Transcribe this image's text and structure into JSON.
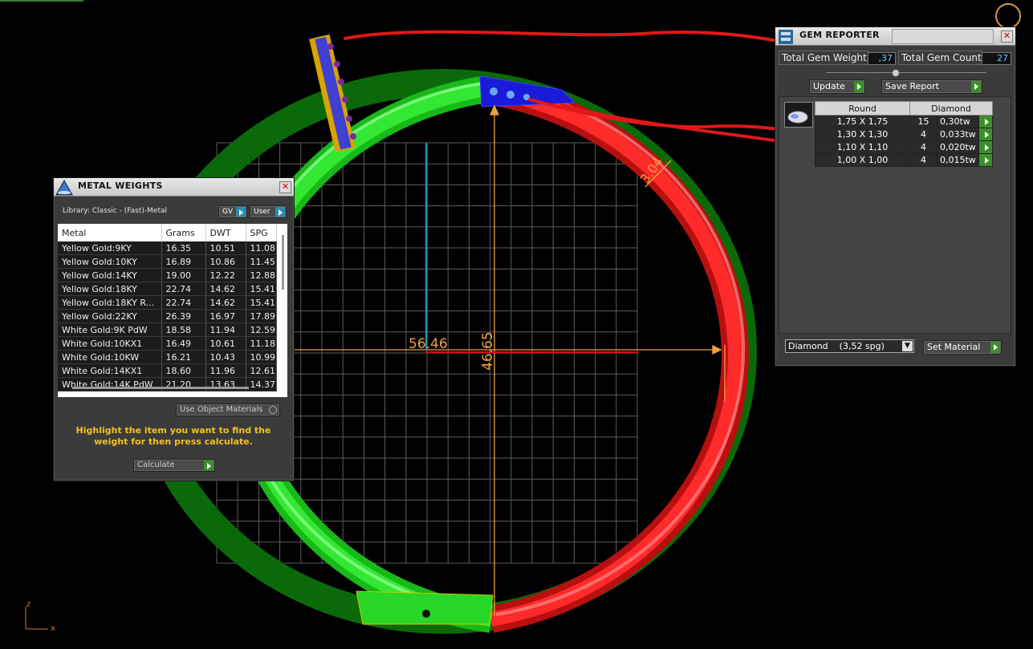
{
  "viewport": {
    "dim_horizontal": "56.46",
    "dim_vertical": "46.65",
    "dim_thickness": "3.04",
    "axis_z": "z",
    "axis_x": "x",
    "colors": {
      "green_ring": "#22cc22",
      "red_ring": "#dd1a1a",
      "dim_line": "#f0a040",
      "grid": "#6a6a6a"
    }
  },
  "metal_weights": {
    "title": "METAL WEIGHTS",
    "library_label": "Library: Classic - (Fast)-Metal",
    "gv_label": "GV",
    "user_label": "User",
    "columns": [
      "Metal",
      "Grams",
      "DWT",
      "SPG"
    ],
    "rows": [
      [
        "Yellow Gold:9KY",
        "16.35",
        "10.51",
        "11.08"
      ],
      [
        "Yellow Gold:10KY",
        "16.89",
        "10.86",
        "11.45"
      ],
      [
        "Yellow Gold:14KY",
        "19.00",
        "12.22",
        "12.88"
      ],
      [
        "Yellow Gold:18KY",
        "22.74",
        "14.62",
        "15.41"
      ],
      [
        "Yellow Gold:18KY R...",
        "22.74",
        "14.62",
        "15.41"
      ],
      [
        "Yellow Gold:22KY",
        "26.39",
        "16.97",
        "17.89"
      ],
      [
        "White Gold:9K PdW",
        "18.58",
        "11.94",
        "12.59"
      ],
      [
        "White Gold:10KX1",
        "16.49",
        "10.61",
        "11.18"
      ],
      [
        "White Gold:10KW",
        "16.21",
        "10.43",
        "10.99"
      ],
      [
        "White Gold:14KX1",
        "18.60",
        "11.96",
        "12.61"
      ],
      [
        "White Gold:14K PdW",
        "21.20",
        "13.63",
        "14.37"
      ]
    ],
    "use_object_materials": "Use Object Materials",
    "hint": "Highlight the item you want to find the weight for then press calculate.",
    "calculate_label": "Calculate"
  },
  "gem_reporter": {
    "title": "GEM REPORTER",
    "total_weight_label": "Total Gem Weight",
    "total_weight_value": ",37",
    "total_count_label": "Total Gem Count",
    "total_count_value": "27",
    "update_label": "Update",
    "save_report_label": "Save Report",
    "headers": [
      "Round",
      "Diamond"
    ],
    "rows": [
      [
        "1,75 X 1,75",
        "15",
        "0,30tw"
      ],
      [
        "1,30 X 1,30",
        "4",
        "0,033tw"
      ],
      [
        "1,10 X 1,10",
        "4",
        "0,020tw"
      ],
      [
        "1,00 X 1,00",
        "4",
        "0,015tw"
      ]
    ],
    "material_select": "Diamond    (3,52 spg)",
    "set_material_label": "Set Material"
  }
}
